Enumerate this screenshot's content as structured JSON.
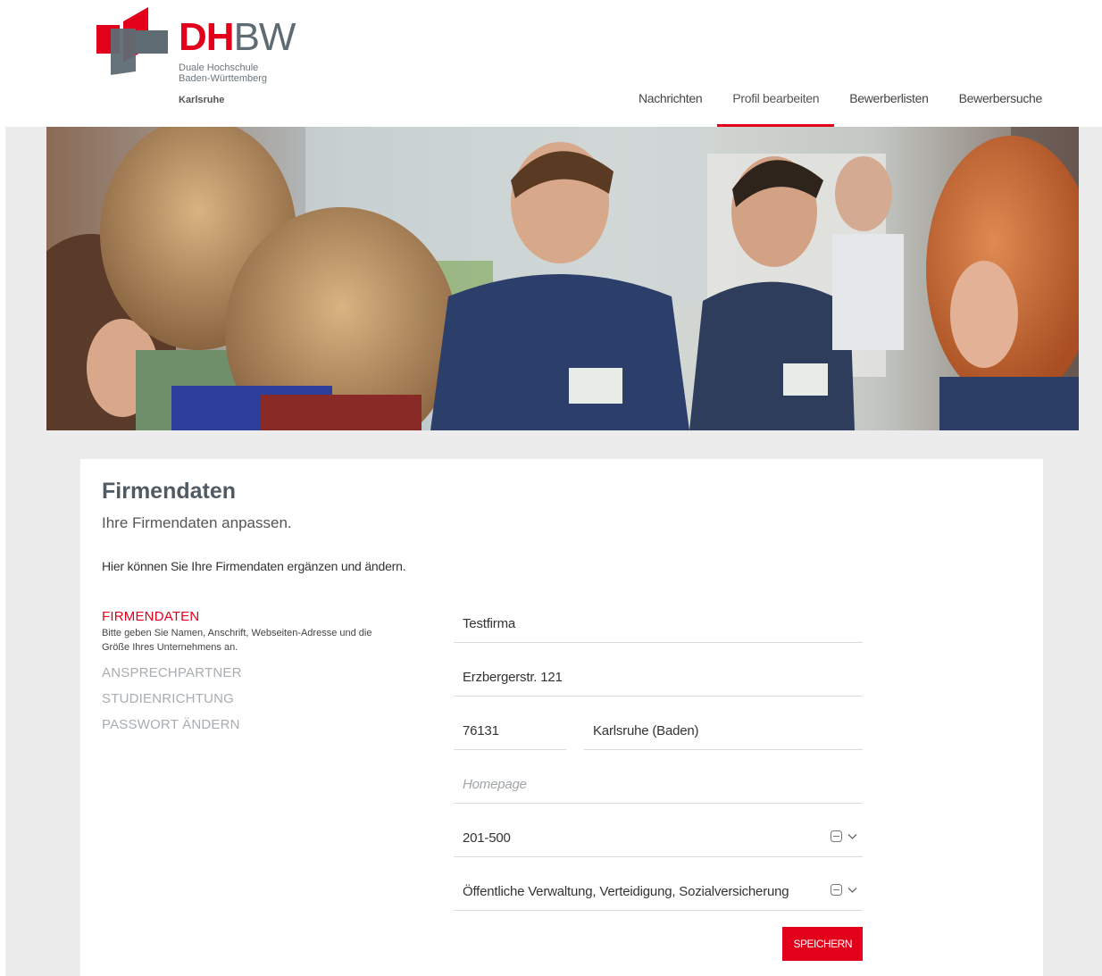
{
  "logo": {
    "word_dh": "DH",
    "word_bw": "BW",
    "line1": "Duale Hochschule",
    "line2": "Baden-Württemberg",
    "city": "Karlsruhe"
  },
  "nav": [
    "Nachrichten",
    "Profil bearbeiten",
    "Bewerberlisten",
    "Bewerbersuche"
  ],
  "nav_active_index": 1,
  "card": {
    "title": "Firmendaten",
    "subtitle": "Ihre Firmendaten anpassen.",
    "intro": "Hier können Sie Ihre Firmendaten ergänzen und ändern."
  },
  "sidenav": {
    "items": [
      "FIRMENDATEN",
      "ANSPRECHPARTNER",
      "STUDIENRICHTUNG",
      "PASSWORT ÄNDERN"
    ],
    "active_desc": "Bitte geben Sie Namen, Anschrift, Webseiten-Adresse und die Größe Ihres Unternehmens an."
  },
  "form": {
    "company_name": "Testfirma",
    "street": "Erzbergerstr. 121",
    "zip": "76131",
    "city": "Karlsruhe (Baden)",
    "homepage_placeholder": "Homepage",
    "company_size": "201-500",
    "industry": "Öffentliche Verwaltung, Verteidigung, Sozialversicherung"
  },
  "save_label": "SPEICHERN",
  "colors": {
    "accent": "#e2001a",
    "page_bg": "#ececec",
    "logo_grey": "#5f6b73"
  },
  "icons": [
    "dhbw-logo-mark",
    "select-clear-icon",
    "chevron-down-icon"
  ]
}
